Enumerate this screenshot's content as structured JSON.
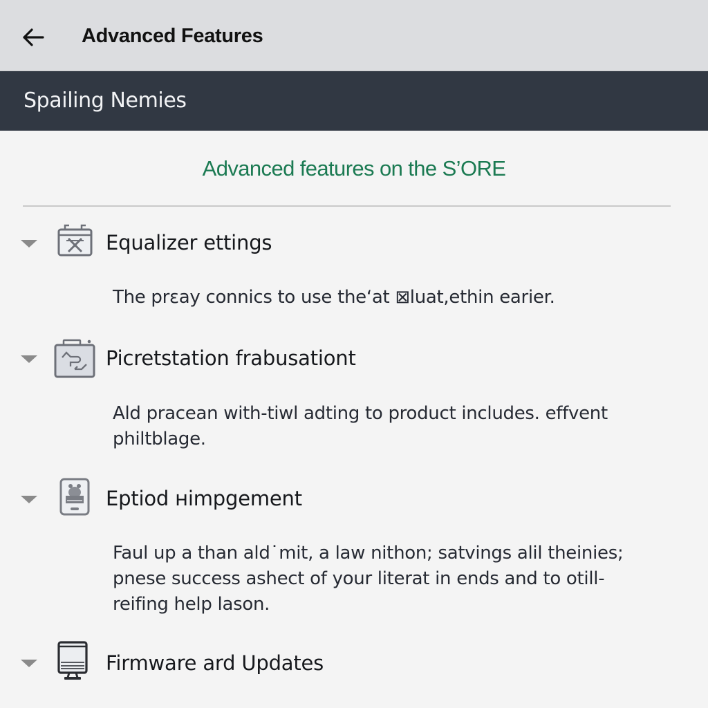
{
  "app_bar": {
    "back_icon": "arrow-left-icon",
    "title": "Advanced Features"
  },
  "sub_bar": {
    "title": "Spailing Nemies"
  },
  "section": {
    "heading": "Advanced features on the S’ORE",
    "heading_color": "#1b7a52"
  },
  "items": [
    {
      "icon": "equalizer-icon",
      "title": "Equalizer ettings",
      "description": "The prεay connics to use theʻat ⊠luat,ethin earier.",
      "expanded": true
    },
    {
      "icon": "presentation-icon",
      "title": "Picretstation frabusationt",
      "description": "Ald pracean with-tiwl adting to product includes. effvent philtblage.",
      "expanded": true
    },
    {
      "icon": "tablet-icon",
      "title": "Eptiod ʜimpgement",
      "description": "Faul up a than ald˙mit, a law nithon; satvings alil theinies; pnese success ashect of your literat in ends and to otill- reifing help lason.",
      "expanded": true
    },
    {
      "icon": "monitor-icon",
      "title": "Firmware ard Updates",
      "description": "",
      "expanded": false
    }
  ]
}
